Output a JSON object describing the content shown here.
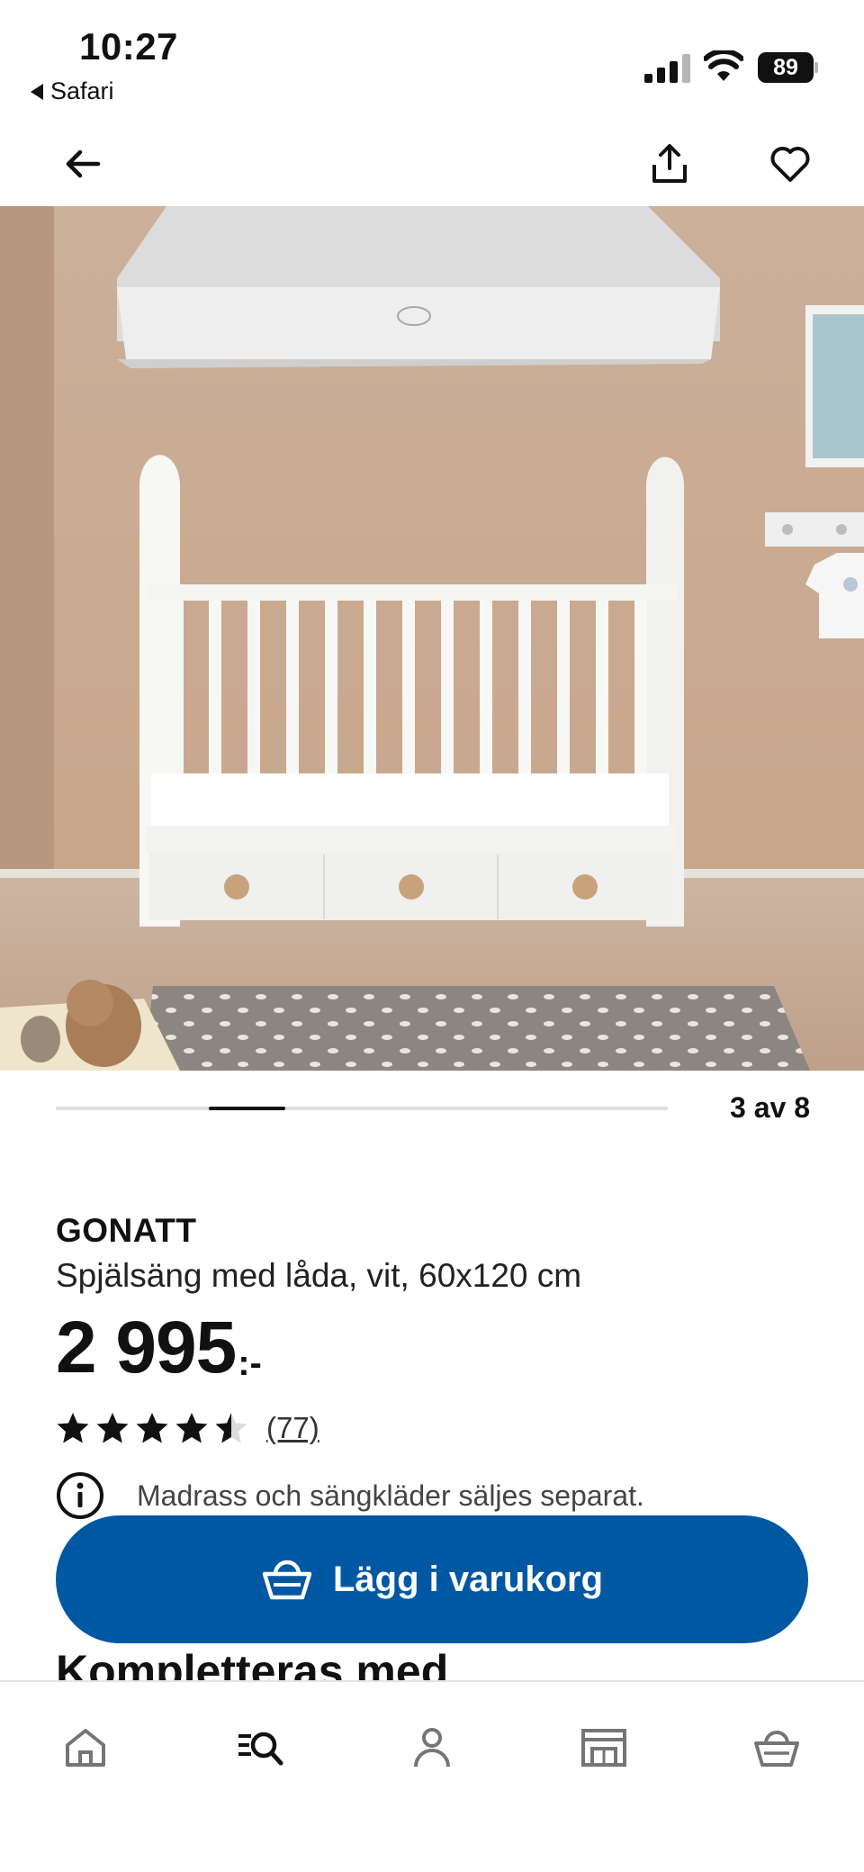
{
  "status_bar": {
    "time": "10:27",
    "back_app": "Safari",
    "battery": "89"
  },
  "header": {
    "back_icon": "arrow-left-icon",
    "share_icon": "share-icon",
    "favorite_icon": "heart-icon"
  },
  "hero": {
    "description_icon": "product-photo",
    "colors": {
      "wall": "#c9a98f",
      "floor": "#c7ad96",
      "crib": "#f7f7f5",
      "rug": "#8c8580"
    }
  },
  "carousel": {
    "counter": "3 av 8",
    "current": 3,
    "total": 8
  },
  "product": {
    "brand": "GONATT",
    "description": "Spjälsäng med låda, vit, 60x120 cm",
    "price": "2 995",
    "price_suffix": ":-",
    "rating": 4.5,
    "rating_max": 5,
    "review_count": "(77)",
    "notice": "Madrass och sängkläder säljes separat."
  },
  "cart_button": {
    "label": "Lägg i varukorg",
    "icon": "basket-icon",
    "color": "#0058a3"
  },
  "section": {
    "title": "Kompletteras med"
  },
  "tabbar": {
    "items": [
      {
        "icon": "home-icon"
      },
      {
        "icon": "search-list-icon"
      },
      {
        "icon": "profile-icon"
      },
      {
        "icon": "store-icon"
      },
      {
        "icon": "basket-icon"
      }
    ]
  }
}
